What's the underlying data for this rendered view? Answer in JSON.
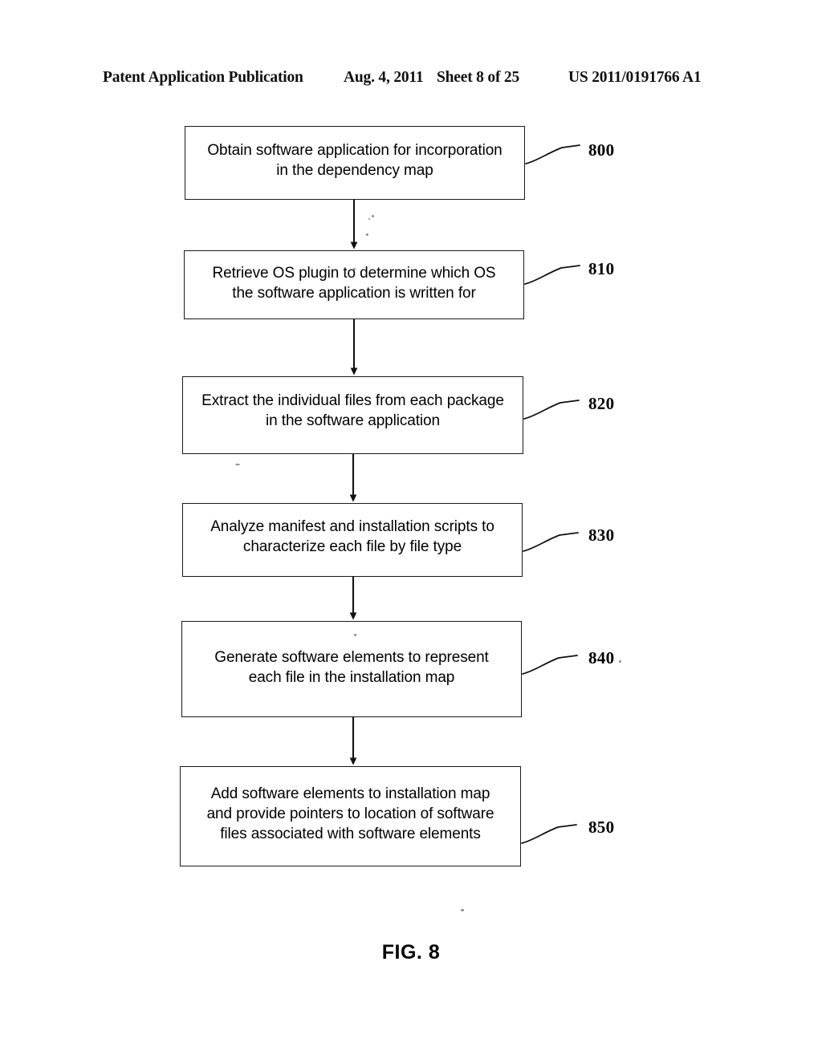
{
  "page": {
    "background_color": "#ffffff",
    "ink_color": "#000000"
  },
  "header": {
    "publication": "Patent Application Publication",
    "date": "Aug. 4, 2011",
    "sheet": "Sheet 8 of 25",
    "patent_number": "US 2011/0191766 A1"
  },
  "figure": {
    "caption": "FIG. 8",
    "type": "flowchart"
  },
  "flowchart": {
    "nodes": [
      {
        "ref": "800",
        "text": "Obtain software application for incorporation\nin the dependency map",
        "lines": [
          "Obtain software application for incorporation",
          "in the dependency map"
        ]
      },
      {
        "ref": "810",
        "text": "Retrieve OS plugin to determine which OS\nthe software application is written for",
        "lines": [
          "Retrieve OS plugin to determine which OS",
          "the software application is written for"
        ]
      },
      {
        "ref": "820",
        "text": "Extract the individual files from each package\nin the software application",
        "lines": [
          "Extract the individual files from each package",
          "in the software application"
        ]
      },
      {
        "ref": "830",
        "text": "Analyze manifest and installation scripts to\ncharacterize each file by file type",
        "lines": [
          "Analyze manifest and installation scripts to",
          "characterize each file by file type"
        ]
      },
      {
        "ref": "840",
        "text": "Generate software elements to represent\neach file in the installation map",
        "lines": [
          "Generate software elements to represent",
          "each file in the installation map"
        ]
      },
      {
        "ref": "850",
        "text": "Add software elements to installation map\nand provide pointers to location of software\nfiles associated with software elements",
        "lines": [
          "Add software elements to installation map",
          "and provide pointers to location of software",
          "files associated with software elements"
        ]
      }
    ],
    "edges": [
      {
        "from": "800",
        "to": "810",
        "style": "arrow-down"
      },
      {
        "from": "810",
        "to": "820",
        "style": "arrow-down"
      },
      {
        "from": "820",
        "to": "830",
        "style": "arrow-down"
      },
      {
        "from": "830",
        "to": "840",
        "style": "arrow-down"
      },
      {
        "from": "840",
        "to": "850",
        "style": "arrow-down"
      }
    ]
  }
}
